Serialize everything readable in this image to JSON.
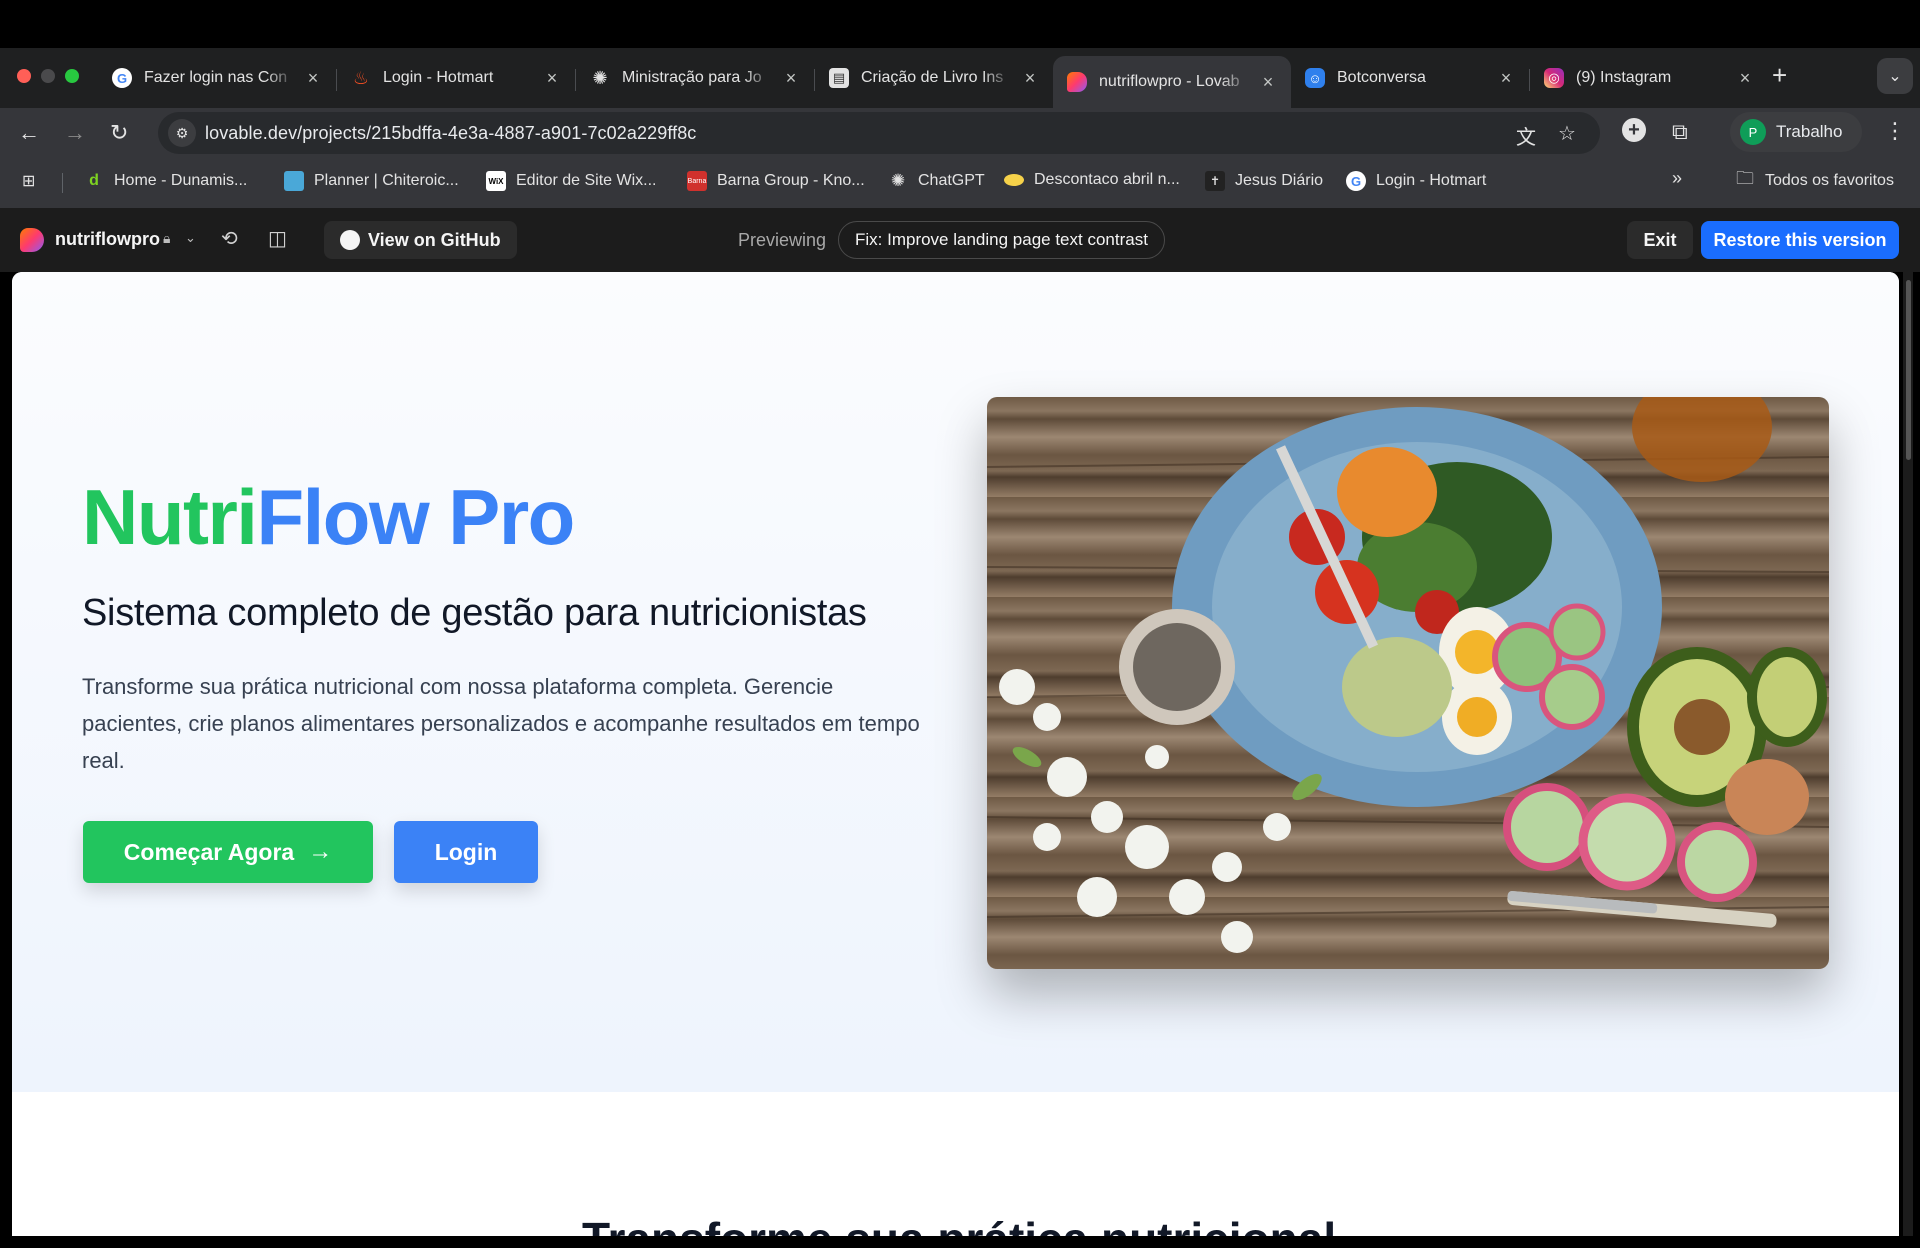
{
  "browser": {
    "tabs": [
      {
        "title": "Fazer login nas Con",
        "icon": "google-icon",
        "icon_color": "#4285f4"
      },
      {
        "title": "Login - Hotmart",
        "icon": "hotmart-icon",
        "icon_color": "#f04e23"
      },
      {
        "title": "Ministração para Jo",
        "icon": "openai-icon",
        "icon_color": "#e3e3e3"
      },
      {
        "title": "Criação de Livro Ins",
        "icon": "page-icon",
        "icon_color": "#e3e3e3"
      },
      {
        "title": "nutriflowpro - Lovab",
        "icon": "lovable-icon",
        "icon_color": "#fe3a6e",
        "active": true
      },
      {
        "title": "Botconversa",
        "icon": "botconversa-icon",
        "icon_color": "#2f80ed"
      },
      {
        "title": "(9) Instagram",
        "icon": "instagram-icon",
        "icon_color": "#e1306c"
      }
    ],
    "new_tab": "+",
    "url": "lovable.dev/projects/215bdffa-4e3a-4887-a901-7c02a229ff8c",
    "profile_initial": "P",
    "profile_name": "Trabalho",
    "bookmarks": [
      {
        "label": "Home - Dunamis...",
        "icon": "dunamis-icon"
      },
      {
        "label": "Planner | Chiteroic...",
        "icon": "planner-icon"
      },
      {
        "label": "Editor de Site Wix...",
        "icon": "wix-icon"
      },
      {
        "label": "Barna Group - Kno...",
        "icon": "barna-icon"
      },
      {
        "label": "ChatGPT",
        "icon": "openai-icon"
      },
      {
        "label": "Descontaco abril n...",
        "icon": "descontaco-icon"
      },
      {
        "label": "Jesus Diário",
        "icon": "jesus-icon"
      },
      {
        "label": "Login - Hotmart",
        "icon": "google-icon"
      }
    ],
    "bookmarks_overflow": "»",
    "all_bookmarks": "Todos os favoritos"
  },
  "lovable": {
    "project_name": "nutriflowpro",
    "github_label": "View on GitHub",
    "previewing_label": "Previewing",
    "version_label": "Fix: Improve landing page text contrast",
    "exit_label": "Exit",
    "restore_label": "Restore this version"
  },
  "page": {
    "title_part1": "Nutri",
    "title_part2": "Flow Pro",
    "subtitle": "Sistema completo de gestão para nutricionistas",
    "description": "Transforme sua prática nutricional com nossa plataforma completa. Gerencie pacientes, crie planos alimentares personalizados e acompanhe resultados em tempo real.",
    "cta_primary": "Começar Agora",
    "cta_secondary": "Login",
    "next_section_heading": "Transforme sua prática nutricional",
    "colors": {
      "green": "#22c55e",
      "blue": "#3b82f6"
    }
  }
}
